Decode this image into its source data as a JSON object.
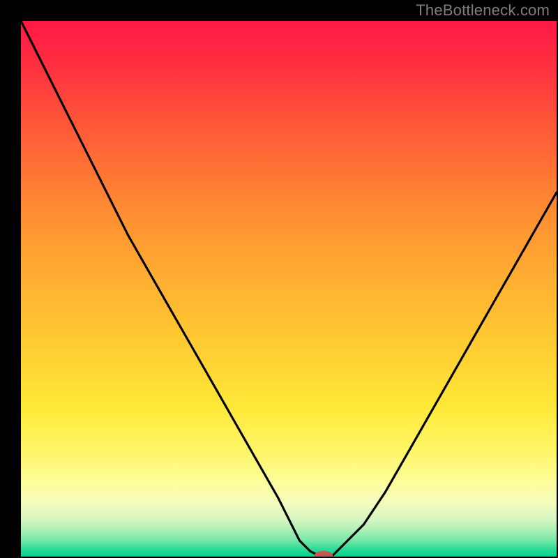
{
  "watermark": "TheBottleneck.com",
  "colors": {
    "gradient_top": "#ff1945",
    "gradient_mid": "#ffd433",
    "gradient_bottom": "#00d48e",
    "curve": "#000000",
    "marker": "#c05a55",
    "frame": "#000000"
  },
  "chart_data": {
    "type": "line",
    "title": "",
    "xlabel": "",
    "ylabel": "",
    "xlim": [
      0,
      100
    ],
    "ylim": [
      0,
      100
    ],
    "grid": false,
    "legend": false,
    "series": [
      {
        "name": "bottleneck-curve",
        "x": [
          0,
          4,
          8,
          12,
          16,
          20,
          24,
          28,
          32,
          36,
          40,
          44,
          48,
          50,
          52,
          54,
          56,
          58,
          60,
          64,
          68,
          72,
          76,
          80,
          84,
          88,
          92,
          96,
          100
        ],
        "values": [
          100,
          92,
          84,
          76,
          68,
          60,
          53,
          46,
          39,
          32,
          25,
          18,
          11,
          7,
          3,
          1,
          0,
          0,
          2,
          6,
          12,
          19,
          26,
          33,
          40,
          47,
          54,
          61,
          68
        ]
      }
    ],
    "marker": {
      "x": 56.5,
      "y": 0,
      "rx": 1.8,
      "ry": 1.1
    },
    "background_gradient": {
      "direction": "vertical",
      "stops": [
        {
          "pos": 0.0,
          "color": "#ff1945"
        },
        {
          "pos": 0.5,
          "color": "#ffbd32"
        },
        {
          "pos": 0.85,
          "color": "#fdfd9a"
        },
        {
          "pos": 1.0,
          "color": "#00d48e"
        }
      ]
    }
  }
}
